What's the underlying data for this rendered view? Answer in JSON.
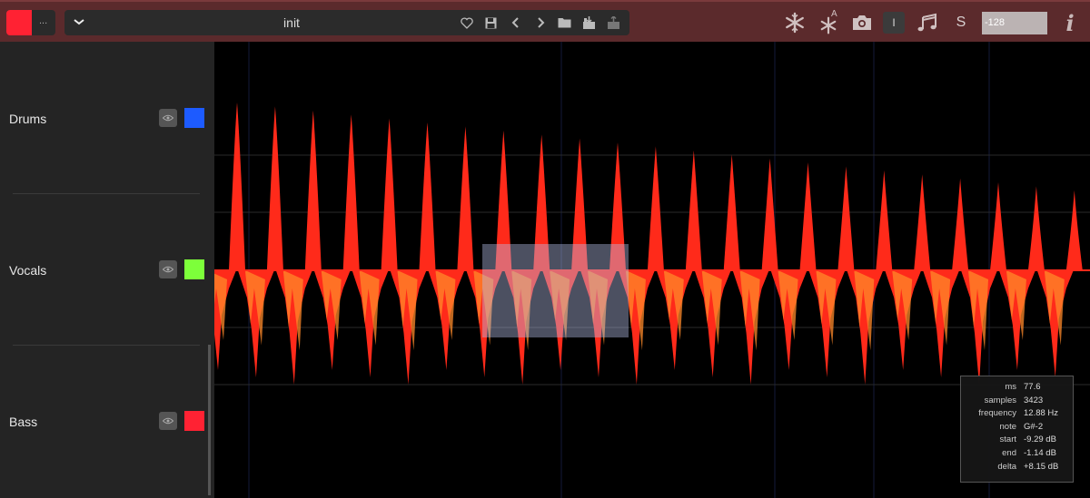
{
  "toolbar": {
    "color_swatch": "#ff2233",
    "swatch_menu_label": "...",
    "preset_name": "init",
    "icons": [
      "chevron-down-icon",
      "heart-icon",
      "save-icon",
      "prev-icon",
      "next-icon",
      "folder-icon",
      "import-icon",
      "export-icon"
    ],
    "tools": {
      "freeze_icon": "snowflake-icon",
      "auto_freeze_icon": "snowflake-auto-icon",
      "auto_freeze_badge": "A",
      "camera_icon": "camera-icon",
      "cursor_label": "I",
      "note_icon": "music-note-icon",
      "s_label": "S",
      "info_label": "i"
    },
    "gain_value": "-128"
  },
  "tracks": [
    {
      "name": "Drums",
      "color": "#1d5bff"
    },
    {
      "name": "Vocals",
      "color": "#7dff3a"
    },
    {
      "name": "Bass",
      "color": "#ff2233"
    }
  ],
  "waveform": {
    "color": "#ff2a1a",
    "accent": "#ff8a2a"
  },
  "info": {
    "rows": [
      {
        "label": "ms",
        "value": "77.6"
      },
      {
        "label": "samples",
        "value": "3423"
      },
      {
        "label": "frequency",
        "value": "12.88 Hz"
      },
      {
        "label": "note",
        "value": "G#-2"
      },
      {
        "label": "start",
        "value": "-9.29 dB"
      },
      {
        "label": "end",
        "value": "-1.14 dB"
      },
      {
        "label": "delta",
        "value": "+8.15 dB"
      }
    ]
  }
}
